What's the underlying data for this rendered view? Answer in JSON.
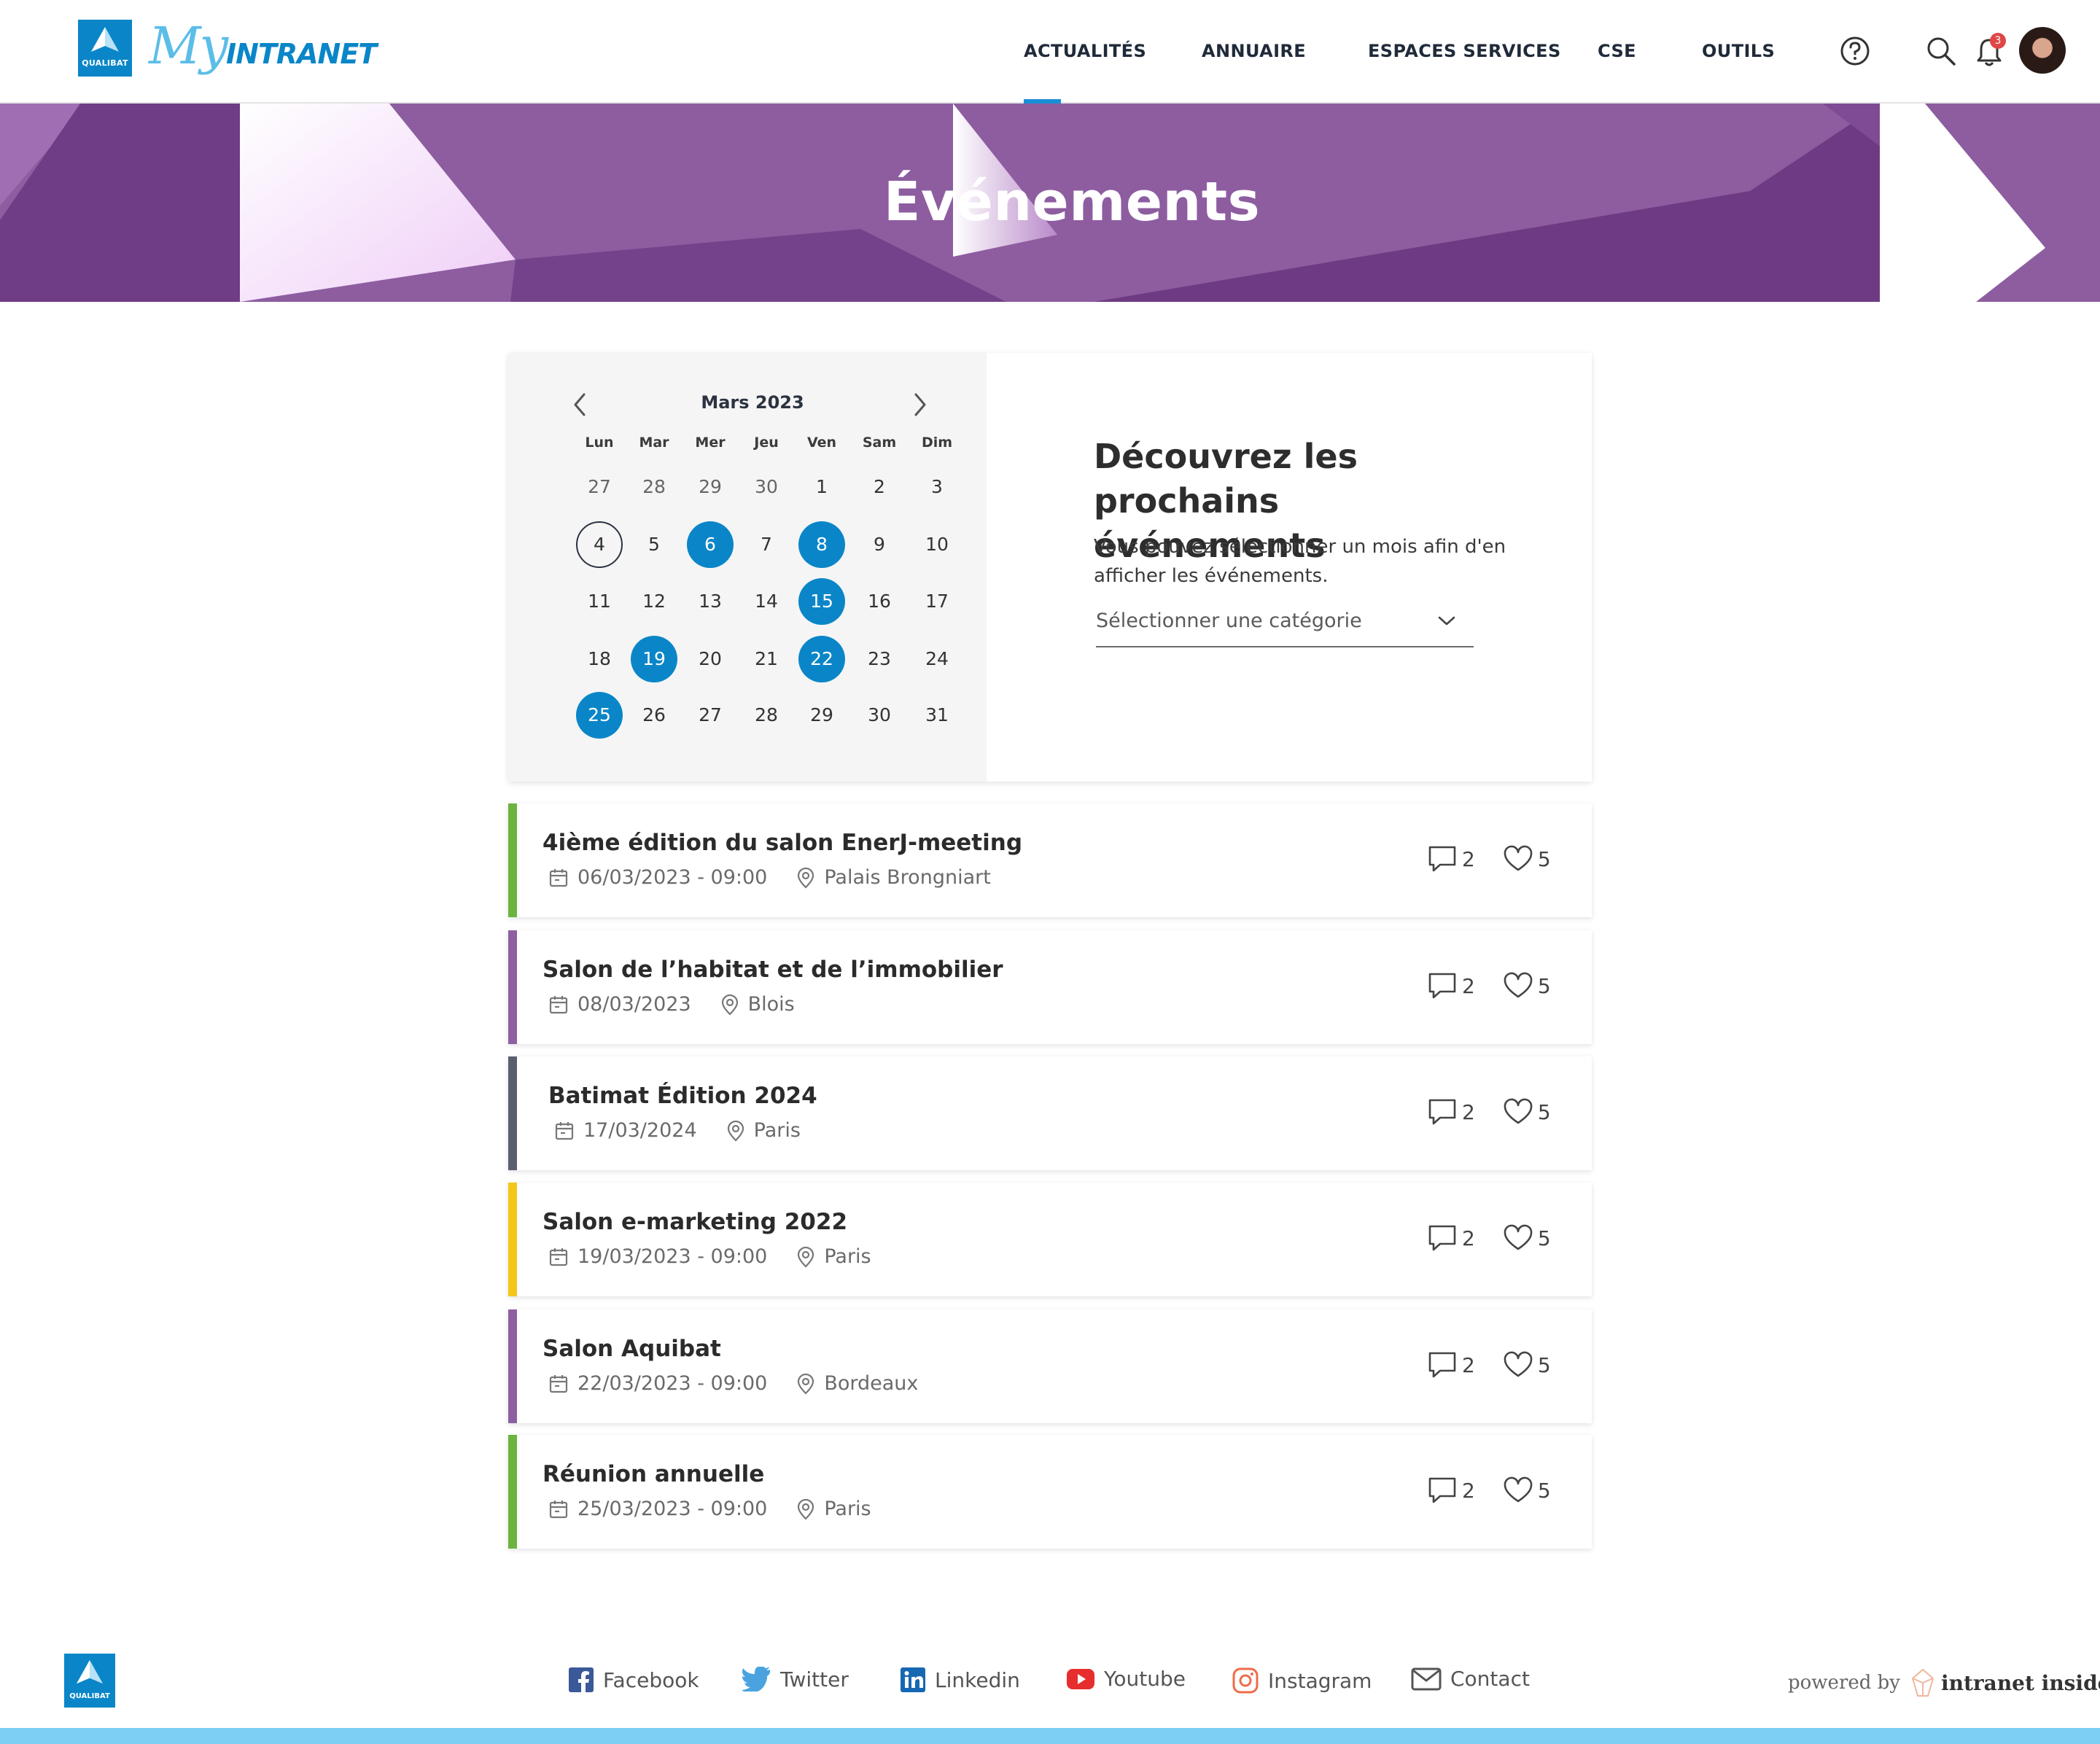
{
  "brand": {
    "logo_label": "QUALIBAT",
    "my": "My",
    "intranet": "INTRANET"
  },
  "nav": {
    "items": [
      "ACTUALITÉS",
      "ANNUAIRE",
      "ESPACES SERVICES",
      "CSE",
      "OUTILS"
    ],
    "active": "ACTUALITÉS",
    "notifications_count": "3"
  },
  "colors": {
    "accent": "#0a86c8",
    "banner": "#8d5da0",
    "active_underline": "#1a8fd6",
    "badge": "#e04646"
  },
  "banner": {
    "title": "Événements"
  },
  "calendar": {
    "month_label": "Mars 2023",
    "weekdays": [
      "Lun",
      "Mar",
      "Mer",
      "Jeu",
      "Ven",
      "Sam",
      "Dim"
    ],
    "weeks": [
      [
        "27",
        "28",
        "29",
        "30",
        "1",
        "2",
        "3"
      ],
      [
        "4",
        "5",
        "6",
        "7",
        "8",
        "9",
        "10"
      ],
      [
        "11",
        "12",
        "13",
        "14",
        "15",
        "16",
        "17"
      ],
      [
        "18",
        "19",
        "20",
        "21",
        "22",
        "23",
        "24"
      ],
      [
        "25",
        "26",
        "27",
        "28",
        "29",
        "30",
        "31"
      ]
    ],
    "event_days": [
      "6",
      "8",
      "15",
      "19",
      "22",
      "25"
    ],
    "today": "4"
  },
  "discover": {
    "title_line1": "Découvrez les prochains",
    "title_line2": "événements",
    "text_line1": "Vous pouvez sélectionner un mois afin d'en",
    "text_line2": "afficher les événements.",
    "category_placeholder": "Sélectionner une catégorie"
  },
  "events": [
    {
      "title": "4ième édition du salon EnerJ-meeting",
      "date": "06/03/2023 - 09:00",
      "location": "Palais Brongniart",
      "comments": "2",
      "likes": "5",
      "color": "#6cb33f"
    },
    {
      "title": "Salon de l’habitat et de l’immobilier",
      "date": "08/03/2023",
      "location": "Blois",
      "comments": "2",
      "likes": "5",
      "color": "#8e5fa2"
    },
    {
      "title": "Batimat Édition 2024",
      "date": "17/03/2024",
      "location": "Paris",
      "comments": "2",
      "likes": "5",
      "color": "#5a5f70"
    },
    {
      "title": "Salon e-marketing 2022",
      "date": "19/03/2023 - 09:00",
      "location": "Paris",
      "comments": "2",
      "likes": "5",
      "color": "#f5c518"
    },
    {
      "title": "Salon Aquibat",
      "date": "22/03/2023 - 09:00",
      "location": "Bordeaux",
      "comments": "2",
      "likes": "5",
      "color": "#8e5fa2"
    },
    {
      "title": "Réunion annuelle",
      "date": "25/03/2023 - 09:00",
      "location": "Paris",
      "comments": "2",
      "likes": "5",
      "color": "#6cb33f"
    }
  ],
  "footer": {
    "logo_label": "QUALIBAT",
    "social": [
      {
        "label": "Facebook",
        "icon": "facebook-icon"
      },
      {
        "label": "Twitter",
        "icon": "twitter-icon"
      },
      {
        "label": "Linkedin",
        "icon": "linkedin-icon"
      },
      {
        "label": "Youtube",
        "icon": "youtube-icon"
      },
      {
        "label": "Instagram",
        "icon": "instagram-icon"
      },
      {
        "label": "Contact",
        "icon": "mail-icon"
      }
    ],
    "powered_by": "powered by",
    "powered_brand": "intranet inside"
  }
}
